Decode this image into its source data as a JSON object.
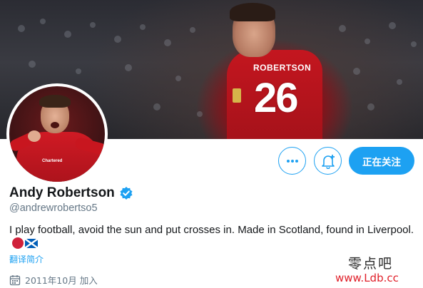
{
  "profile": {
    "display_name": "Andy Robertson",
    "handle": "@andrewrobertso5",
    "verified": true,
    "bio": "I play football, avoid the sun and put crosses in. Made in Scotland, found in Liverpool.",
    "translate_label": "翻译简介",
    "joined": "2011年10月 加入"
  },
  "banner": {
    "jersey_name": "ROBERTSON",
    "jersey_number": "26"
  },
  "avatar": {
    "sponsor_text": "Chartered"
  },
  "actions": {
    "more_icon": "more-dots-icon",
    "notify_icon": "bell-plus-icon",
    "follow_label": "正在关注"
  },
  "watermark": {
    "line1": "零点吧",
    "line2": "www.Ldb.cc"
  },
  "colors": {
    "accent": "#1da1f2",
    "text_primary": "#14171a",
    "text_secondary": "#657786",
    "liverpool_red": "#c4161f"
  }
}
